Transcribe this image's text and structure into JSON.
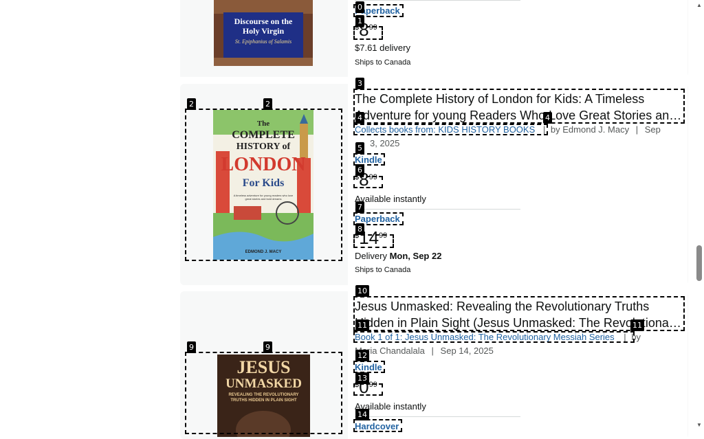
{
  "items": [
    {
      "cover": {
        "title": "Discourse on the Holy Virgin",
        "author": "St. Epiphanius of Salamis"
      },
      "format_label": "Paperback",
      "price": {
        "symbol": "$",
        "whole": "8",
        "fraction": "99"
      },
      "delivery": "$7.61 delivery",
      "ships": "Ships to Canada"
    },
    {
      "title": "The Complete History of London for Kids: A Timeless Adventure for young Readers Who Love Great Stories and Bold Dreams",
      "title_line1": "The Complete History of London for Kids: A Timeless",
      "title_line2": "Adventure for young Readers Who Love Great Stories an…",
      "series": "Collects books from: KIDS HISTORY BOOKS",
      "sep": "|",
      "by": "by",
      "author": "Edmond J. Macy",
      "date": "Sep 3, 2025",
      "date_line1": "Sep",
      "date_line2": "3, 2025",
      "cover": {
        "line1": "The",
        "line2": "COMPLETE",
        "line3": "HISTORY of",
        "line4": "LONDON",
        "line5": "For Kids",
        "blurb": "A timeless adventure for young readers who love great stories and bold dreams",
        "author": "EDMOND J. MACY"
      },
      "formats": [
        {
          "label": "Kindle",
          "price": {
            "symbol": "$",
            "whole": "8",
            "fraction": "99"
          },
          "note": "Available instantly"
        },
        {
          "label": "Paperback",
          "price": {
            "symbol": "$",
            "whole": "14",
            "fraction": "99"
          },
          "delivery_prefix": "Delivery",
          "delivery_date": "Mon, Sep 22",
          "ships": "Ships to Canada"
        }
      ]
    },
    {
      "title_line1": "Jesus Unmasked: Revealing the Revolutionary Truths",
      "title_line2": "Hidden in Plain Sight (Jesus Unmasked: The Revolutiona…",
      "series": "Book 1 of 1: Jesus Unmasked: The Revolutionary Messiah Series",
      "sep": "|",
      "by": "by",
      "author": "Maria Chandalala",
      "date": "Sep 14, 2025",
      "cover": {
        "line1": "JESUS",
        "line2": "UNMASKED",
        "line3": "REVEALING THE REVOLUTIONARY",
        "line4": "TRUTHS HIDDEN IN PLAIN SIGHT"
      },
      "formats": [
        {
          "label": "Kindle",
          "price": {
            "symbol": "$",
            "whole": "0",
            "fraction": "99"
          },
          "note": "Available instantly"
        },
        {
          "label": "Hardcover"
        }
      ]
    }
  ],
  "tags": [
    "0",
    "1",
    "2",
    "2",
    "3",
    "4",
    "4",
    "5",
    "6",
    "7",
    "8",
    "9",
    "9",
    "10",
    "11",
    "11",
    "12",
    "13",
    "14"
  ]
}
